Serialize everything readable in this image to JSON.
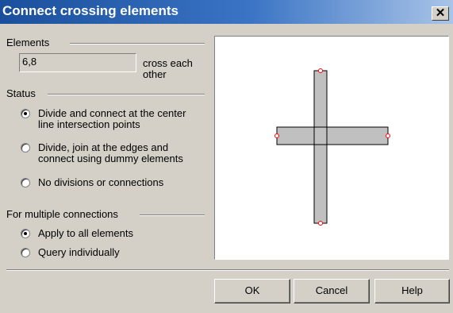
{
  "dialog": {
    "title": "Connect crossing elements",
    "close_glyph": "✕"
  },
  "elements_group": {
    "label": "Elements",
    "value": "6,8",
    "suffix_line1": "cross each",
    "suffix_line2": "other"
  },
  "status_group": {
    "label": "Status",
    "options": [
      {
        "line1": "Divide and connect at the center",
        "line2": "line intersection points",
        "checked": true
      },
      {
        "line1": "Divide, join at the edges and",
        "line2": "connect using dummy elements",
        "checked": false
      },
      {
        "line1": "No divisions or connections",
        "line2": "",
        "checked": false
      }
    ]
  },
  "multiple_group": {
    "label": "For multiple connections",
    "options": [
      {
        "label": "Apply to all elements",
        "checked": true
      },
      {
        "label": "Query individually",
        "checked": false
      }
    ]
  },
  "preview": {
    "fill_color": "#c0c0c0",
    "stroke_color": "#000000",
    "node_color": "#ff0000"
  },
  "buttons": {
    "ok": "OK",
    "cancel": "Cancel",
    "help": "Help"
  }
}
